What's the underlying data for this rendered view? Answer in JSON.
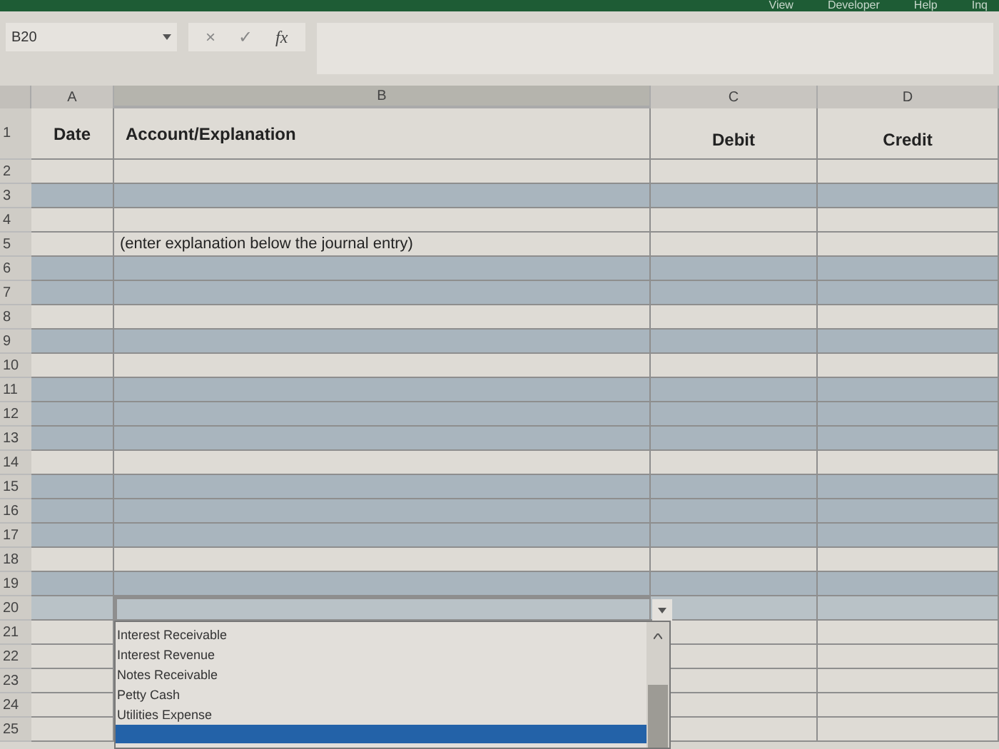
{
  "ribbon": {
    "tabs": [
      {
        "label": "View"
      },
      {
        "label": "Developer"
      },
      {
        "label": "Help"
      },
      {
        "label": "Inq"
      }
    ]
  },
  "formula_bar": {
    "name_box": "B20",
    "cancel": "×",
    "enter": "✓",
    "function": "fx"
  },
  "columns": [
    {
      "label": "A"
    },
    {
      "label": "B"
    },
    {
      "label": "C"
    },
    {
      "label": "D"
    }
  ],
  "rows": [
    {
      "number": "1",
      "shaded": false,
      "selected": false,
      "a": "Date",
      "b": "Account/Explanation",
      "c": "Debit",
      "d": "Credit"
    },
    {
      "number": "2",
      "shaded": false,
      "selected": false
    },
    {
      "number": "3",
      "shaded": true,
      "selected": false
    },
    {
      "number": "4",
      "shaded": false,
      "selected": false
    },
    {
      "number": "5",
      "shaded": false,
      "selected": false,
      "b": "(enter explanation below the journal entry)"
    },
    {
      "number": "6",
      "shaded": true,
      "selected": false
    },
    {
      "number": "7",
      "shaded": true,
      "selected": false
    },
    {
      "number": "8",
      "shaded": false,
      "selected": false
    },
    {
      "number": "9",
      "shaded": true,
      "selected": false
    },
    {
      "number": "10",
      "shaded": false,
      "selected": false
    },
    {
      "number": "11",
      "shaded": true,
      "selected": false
    },
    {
      "number": "12",
      "shaded": true,
      "selected": false
    },
    {
      "number": "13",
      "shaded": true,
      "selected": false
    },
    {
      "number": "14",
      "shaded": false,
      "selected": false
    },
    {
      "number": "15",
      "shaded": true,
      "selected": false
    },
    {
      "number": "16",
      "shaded": true,
      "selected": false
    },
    {
      "number": "17",
      "shaded": true,
      "selected": false
    },
    {
      "number": "18",
      "shaded": false,
      "selected": false
    },
    {
      "number": "19",
      "shaded": true,
      "selected": false
    },
    {
      "number": "20",
      "shaded": true,
      "selected": true
    },
    {
      "number": "21",
      "shaded": false,
      "selected": false
    },
    {
      "number": "22",
      "shaded": false,
      "selected": false
    },
    {
      "number": "23",
      "shaded": false,
      "selected": false
    },
    {
      "number": "24",
      "shaded": false,
      "selected": false
    },
    {
      "number": "25",
      "shaded": false,
      "selected": false
    }
  ],
  "dropdown": {
    "items": [
      {
        "label": "Interest Receivable"
      },
      {
        "label": "Interest Revenue"
      },
      {
        "label": "Notes Receivable"
      },
      {
        "label": "Petty Cash"
      },
      {
        "label": "Utilities Expense"
      }
    ],
    "highlight_bar": true
  }
}
